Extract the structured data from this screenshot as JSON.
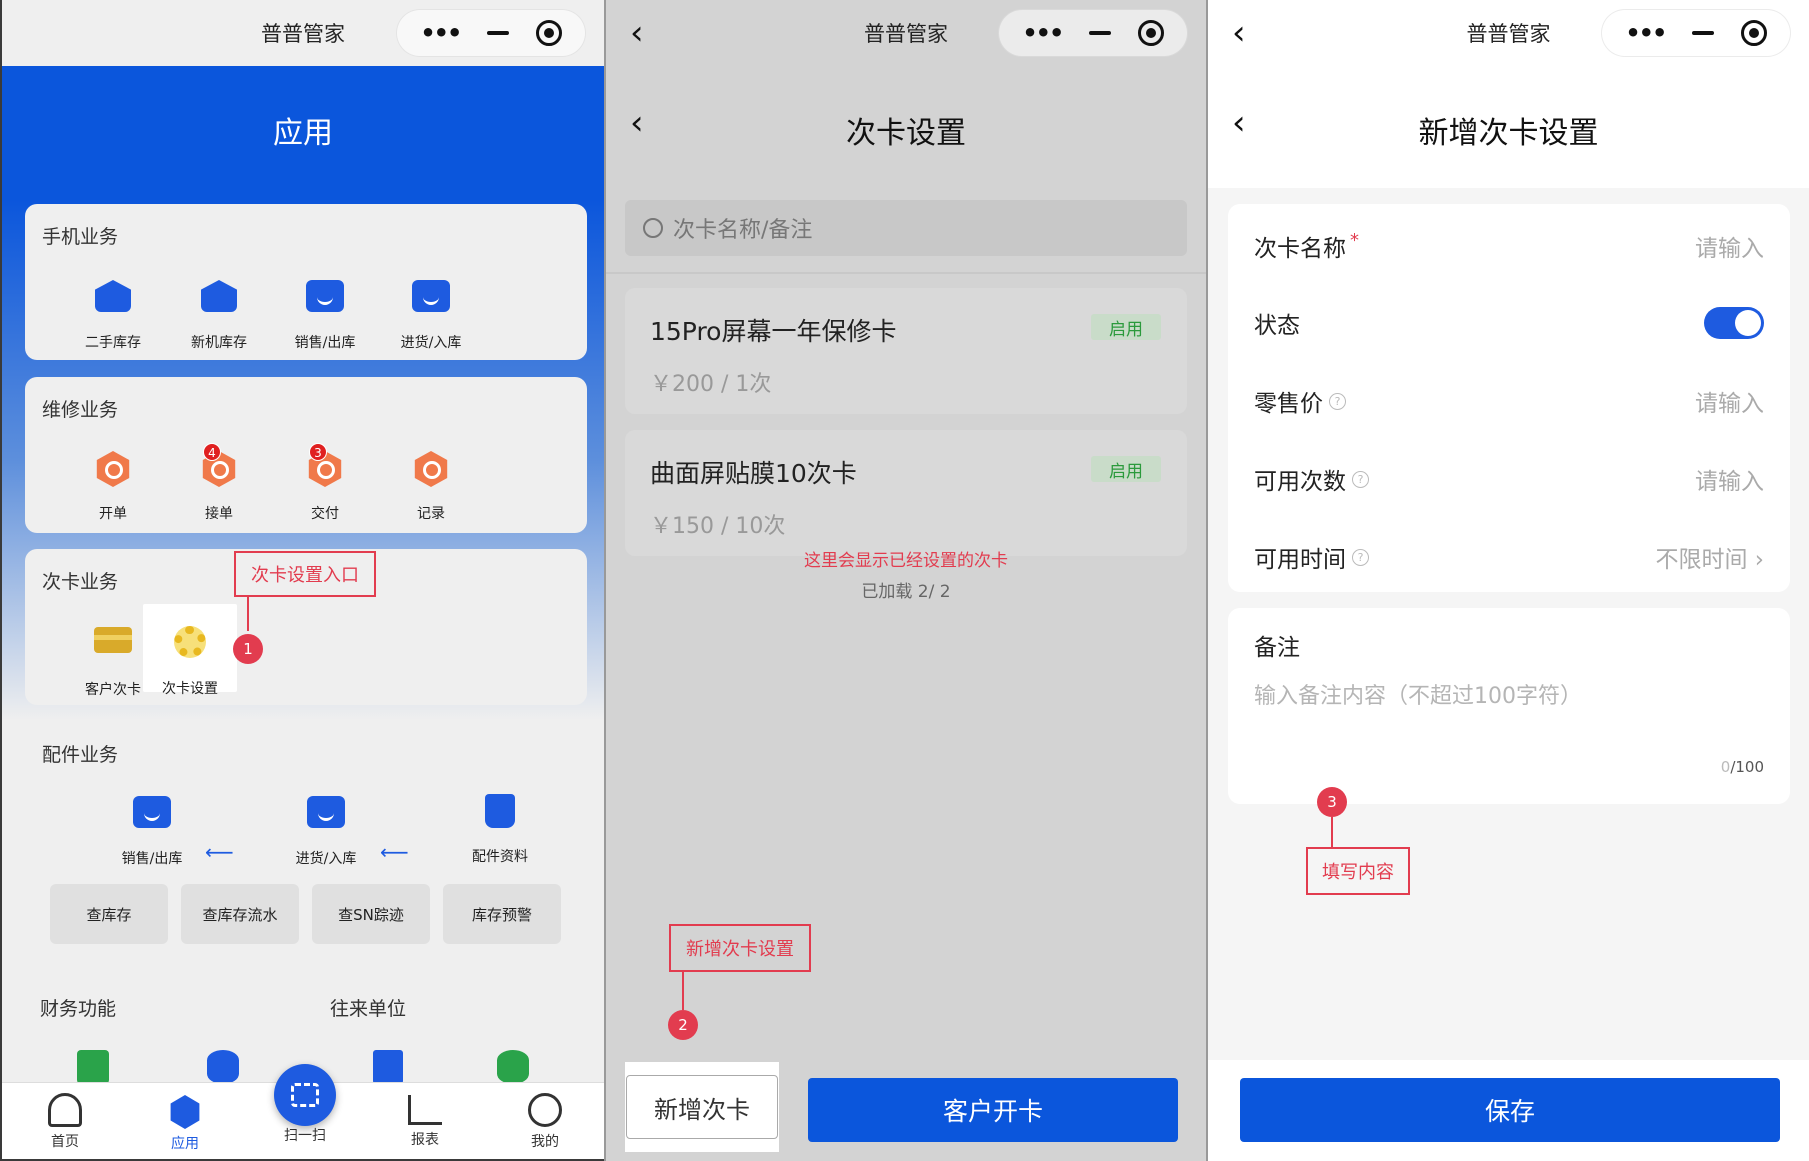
{
  "panel1": {
    "status_title": "普普管家",
    "header_title": "应用",
    "sections": {
      "phone": {
        "title": "手机业务",
        "apps": [
          "二手库存",
          "新机库存",
          "销售/出库",
          "进货/入库"
        ]
      },
      "repair": {
        "title": "维修业务",
        "apps": [
          "开单",
          "接单",
          "交付",
          "记录"
        ],
        "badges": {
          "jiedan": "4",
          "jiaofu": "3"
        }
      },
      "card": {
        "title": "次卡业务",
        "apps": [
          "客户次卡",
          "次卡设置"
        ]
      },
      "parts": {
        "title": "配件业务",
        "apps": [
          "销售/出库",
          "进货/入库",
          "配件资料"
        ],
        "buttons": [
          "查库存",
          "查库存流水",
          "查SN踪迹",
          "库存预警"
        ]
      },
      "finance": {
        "title": "财务功能"
      },
      "contacts": {
        "title": "往来单位"
      }
    },
    "tabbar": [
      "首页",
      "应用",
      "扫一扫",
      "报表",
      "我的"
    ],
    "annotation": {
      "label": "次卡设置入口",
      "step": "1"
    }
  },
  "panel2": {
    "status_title": "普普管家",
    "page_title": "次卡设置",
    "search_placeholder": "次卡名称/备注",
    "cards": [
      {
        "name": "15Pro屏幕一年保修卡",
        "price": "￥200 / 1次",
        "tag": "启用"
      },
      {
        "name": "曲面屏贴膜10次卡",
        "price": "￥150 / 10次",
        "tag": "启用"
      }
    ],
    "note": "这里会显示已经设置的次卡",
    "loaded": "已加载 2/ 2",
    "buttons": {
      "add": "新增次卡",
      "open": "客户开卡"
    },
    "annotation": {
      "label": "新增次卡设置",
      "step": "2"
    }
  },
  "panel3": {
    "status_title": "普普管家",
    "page_title": "新增次卡设置",
    "fields": {
      "name": {
        "label": "次卡名称",
        "required": "*",
        "placeholder": "请输入"
      },
      "status": {
        "label": "状态",
        "enabled": true
      },
      "retail_price": {
        "label": "零售价",
        "placeholder": "请输入"
      },
      "times": {
        "label": "可用次数",
        "placeholder": "请输入"
      },
      "period": {
        "label": "可用时间",
        "value": "不限时间"
      }
    },
    "memo": {
      "label": "备注",
      "placeholder": "输入备注内容（不超过100字符）",
      "count": "0",
      "max": "/100"
    },
    "save": "保存",
    "annotation": {
      "label": "填写内容",
      "step": "3"
    }
  },
  "colors": {
    "brand": "#0b56dc",
    "annotation": "#e23c4f",
    "tag_green": "#2b9a3c"
  }
}
